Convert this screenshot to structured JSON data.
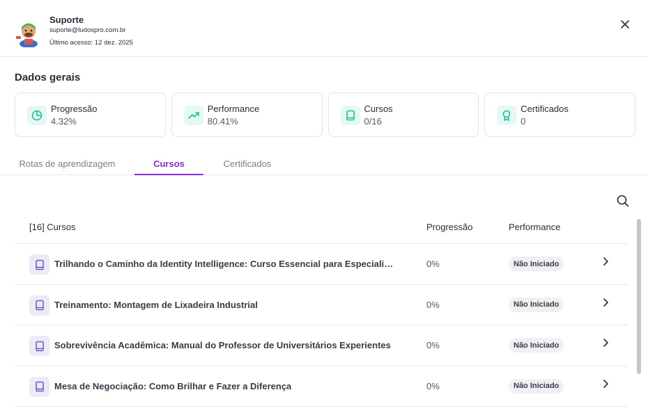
{
  "user": {
    "name": "Suporte",
    "email": "suporte@ludospro.com.br",
    "last_access": "Último acesso: 12 dez. 2025"
  },
  "section_title": "Dados gerais",
  "stats": [
    {
      "label": "Progressão",
      "value": "4.32%",
      "icon": "pie-chart-icon"
    },
    {
      "label": "Performance",
      "value": "80.41%",
      "icon": "trending-up-icon"
    },
    {
      "label": "Cursos",
      "value": "0/16",
      "icon": "book-icon"
    },
    {
      "label": "Certificados",
      "value": "0",
      "icon": "award-icon"
    }
  ],
  "tabs": [
    {
      "label": "Rotas de aprendizagem",
      "active": false
    },
    {
      "label": "Cursos",
      "active": true
    },
    {
      "label": "Certificados",
      "active": false
    }
  ],
  "table": {
    "headers": {
      "title": "[16] Cursos",
      "progress": "Progressão",
      "performance": "Performance"
    },
    "rows": [
      {
        "title": "Trilhando o Caminho da Identity Intelligence: Curso Essencial para Especialistas d...",
        "progress": "0%",
        "status": "Não Iniciado"
      },
      {
        "title": "Treinamento: Montagem de Lixadeira Industrial",
        "progress": "0%",
        "status": "Não Iniciado"
      },
      {
        "title": "Sobrevivência Acadêmica: Manual do Professor de Universitários Experientes",
        "progress": "0%",
        "status": "Não Iniciado"
      },
      {
        "title": "Mesa de Negociação: Como Brilhar e Fazer a Diferença",
        "progress": "0%",
        "status": "Não Iniciado"
      }
    ]
  },
  "colors": {
    "accent": "#8a2be2",
    "stat_icon_bg": "#e6f8f3",
    "stat_icon": "#19c39a",
    "course_icon_bg": "#eceaf7",
    "course_icon": "#6a5acd"
  }
}
